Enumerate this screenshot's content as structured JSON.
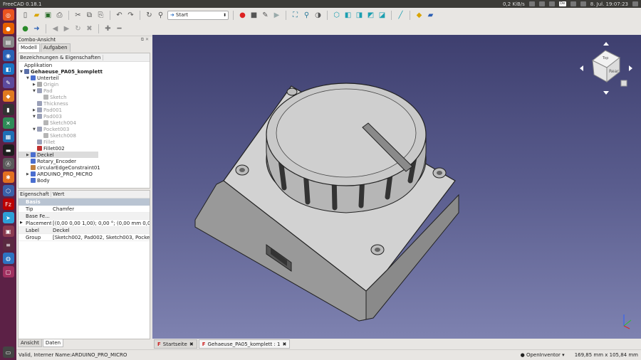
{
  "window": {
    "title": "FreeCAD 0.18.1"
  },
  "tray": {
    "net_speed": "0,2 KiB/s",
    "lang": "De",
    "datetime": "8. Jul. 19:07:23"
  },
  "toolbar": {
    "workbench": "Start"
  },
  "combo": {
    "title": "Combo-Ansicht",
    "tabs": [
      "Modell",
      "Aufgaben"
    ],
    "tree_header": "Bezeichnungen & Eigenschaften",
    "tree": [
      {
        "label": "Applikation",
        "depth": 0,
        "arrow": "",
        "icon": "",
        "style": ""
      },
      {
        "label": "Gehaeuse_PA05_komplett",
        "depth": 0,
        "arrow": "▼",
        "icon": "#5a6fa8",
        "style": "bold"
      },
      {
        "label": "Unterteil",
        "depth": 1,
        "arrow": "▼",
        "icon": "#4a6ecf",
        "style": ""
      },
      {
        "label": "Origin",
        "depth": 2,
        "arrow": "▶",
        "icon": "#aaa",
        "style": "dim"
      },
      {
        "label": "Pad",
        "depth": 2,
        "arrow": "▼",
        "icon": "#9aa0b8",
        "style": "dim"
      },
      {
        "label": "Sketch",
        "depth": 3,
        "arrow": "",
        "icon": "#b5b5b5",
        "style": "dim"
      },
      {
        "label": "Thickness",
        "depth": 2,
        "arrow": "",
        "icon": "#9aa0b8",
        "style": "dim"
      },
      {
        "label": "Pad001",
        "depth": 2,
        "arrow": "▶",
        "icon": "#9aa0b8",
        "style": "dim"
      },
      {
        "label": "Pad003",
        "depth": 2,
        "arrow": "▼",
        "icon": "#9aa0b8",
        "style": "dim"
      },
      {
        "label": "Sketch004",
        "depth": 3,
        "arrow": "",
        "icon": "#b5b5b5",
        "style": "dim"
      },
      {
        "label": "Pocket003",
        "depth": 2,
        "arrow": "▼",
        "icon": "#9aa0b8",
        "style": "dim"
      },
      {
        "label": "Sketch008",
        "depth": 3,
        "arrow": "",
        "icon": "#b5b5b5",
        "style": "dim"
      },
      {
        "label": "Fillet",
        "depth": 2,
        "arrow": "",
        "icon": "#9aa0b8",
        "style": "dim"
      },
      {
        "label": "Fillet002",
        "depth": 2,
        "arrow": "",
        "icon": "#c03030",
        "style": ""
      },
      {
        "label": "Deckel",
        "depth": 1,
        "arrow": "▶",
        "icon": "#4a6ecf",
        "style": "sel"
      },
      {
        "label": "Rotary_Encoder",
        "depth": 1,
        "arrow": "",
        "icon": "#4a6ecf",
        "style": ""
      },
      {
        "label": "circularEdgeConstraint01",
        "depth": 1,
        "arrow": "",
        "icon": "#c08040",
        "style": ""
      },
      {
        "label": "ARDUINO_PRO_MICRO",
        "depth": 1,
        "arrow": "▶",
        "icon": "#4a6ecf",
        "style": ""
      },
      {
        "label": "Body",
        "depth": 1,
        "arrow": "",
        "icon": "#4a6ecf",
        "style": ""
      }
    ],
    "props_header": {
      "property": "Eigenschaft",
      "value": "Wert"
    },
    "props_group": "Basis",
    "props": [
      {
        "key": "Tip",
        "value": "Chamfer",
        "expand": ""
      },
      {
        "key": "Base Fe...",
        "value": "",
        "expand": ""
      },
      {
        "key": "Placement",
        "value": "[(0,00 0,00 1,00); 0,00 °; (0,00 mm  0,00 ...",
        "expand": "▶"
      },
      {
        "key": "Label",
        "value": "Deckel",
        "expand": ""
      },
      {
        "key": "Group",
        "value": "[Sketch002, Pad002, Sketch003, Pocket,...",
        "expand": ""
      }
    ],
    "bottom_tabs": [
      "Ansicht",
      "Daten"
    ]
  },
  "doc_tabs": [
    {
      "label": "Startseite",
      "active": false
    },
    {
      "label": "Gehaeuse_PA05_komplett : 1",
      "active": true
    }
  ],
  "navcube": {
    "top": "Top",
    "face": "Rear"
  },
  "status": {
    "message": "Valid, Interner Name:ARDUINO_PRO_MICRO",
    "nav_style": "OpenInventor",
    "dimensions": "169,85 mm x 105,84 mm"
  }
}
